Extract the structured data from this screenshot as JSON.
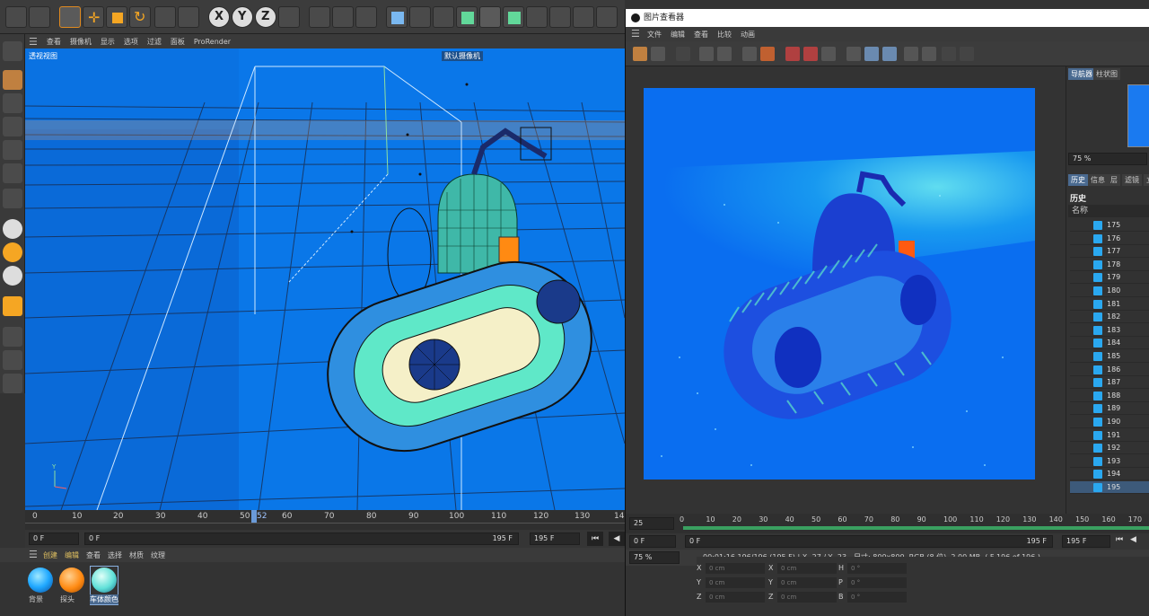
{
  "viewport_menu": [
    "查看",
    "摄像机",
    "显示",
    "选项",
    "过滤",
    "面板",
    "ProRender"
  ],
  "viewport": {
    "label": "透视视图",
    "camera_badge": "默认摄像机"
  },
  "timeline": {
    "ticks": [
      "0",
      "10",
      "20",
      "30",
      "40",
      "50",
      "52",
      "60",
      "70",
      "80",
      "90",
      "100",
      "110",
      "120",
      "130",
      "14"
    ],
    "start_frame": "0 F",
    "range_start": "0 F",
    "range_end": "195 F",
    "end_frame": "195 F"
  },
  "material_menu": [
    "创建",
    "编辑",
    "查看",
    "选择",
    "材质",
    "纹理"
  ],
  "materials": [
    {
      "label": "背景",
      "color": "#1fa8ff"
    },
    {
      "label": "探头",
      "color": "#ff8a12"
    },
    {
      "label": "车体颜色",
      "color": "#5fe0d8"
    }
  ],
  "picture_viewer": {
    "title": "图片查看器",
    "menu": [
      "文件",
      "编辑",
      "查看",
      "比较",
      "动画"
    ],
    "side_tabs": [
      "导航器",
      "柱状图"
    ],
    "zoom": "75 %",
    "history_tabs": [
      "历史",
      "信息",
      "层",
      "滤镜",
      "立"
    ],
    "history_title": "历史",
    "history_col": "名称",
    "history_rows": [
      "175",
      "176",
      "177",
      "178",
      "179",
      "180",
      "181",
      "182",
      "183",
      "184",
      "185",
      "186",
      "187",
      "188",
      "189",
      "190",
      "191",
      "192",
      "193",
      "194",
      "195"
    ],
    "fps": "25",
    "tl_ticks": [
      "0",
      "10",
      "20",
      "30",
      "40",
      "50",
      "60",
      "70",
      "80",
      "90",
      "100",
      "110",
      "120",
      "130",
      "140",
      "150",
      "160",
      "170"
    ],
    "start_frame": "0 F",
    "range_start": "0 F",
    "range_end": "195 F",
    "end_frame": "195 F",
    "status_zoom": "75 %",
    "status_text": "00:01:16 196/196 (195 F)  |  X -27 / Y -23 - 尺寸: 800x800, RGB (8 位), 2.00 MB,  ( F 196 of 196 )",
    "coords": [
      {
        "a": "X",
        "v1": "0 cm",
        "b": "X",
        "v2": "0 cm",
        "c": "H",
        "v3": "0 °"
      },
      {
        "a": "Y",
        "v1": "0 cm",
        "b": "Y",
        "v2": "0 cm",
        "c": "P",
        "v3": "0 °"
      },
      {
        "a": "Z",
        "v1": "0 cm",
        "b": "Z",
        "v2": "0 cm",
        "c": "B",
        "v3": "0 °"
      }
    ]
  },
  "colors": {
    "viewport_bg": "#0a77e8",
    "accent_orange": "#ff8a12",
    "selection_blue": "#4a6a90"
  }
}
